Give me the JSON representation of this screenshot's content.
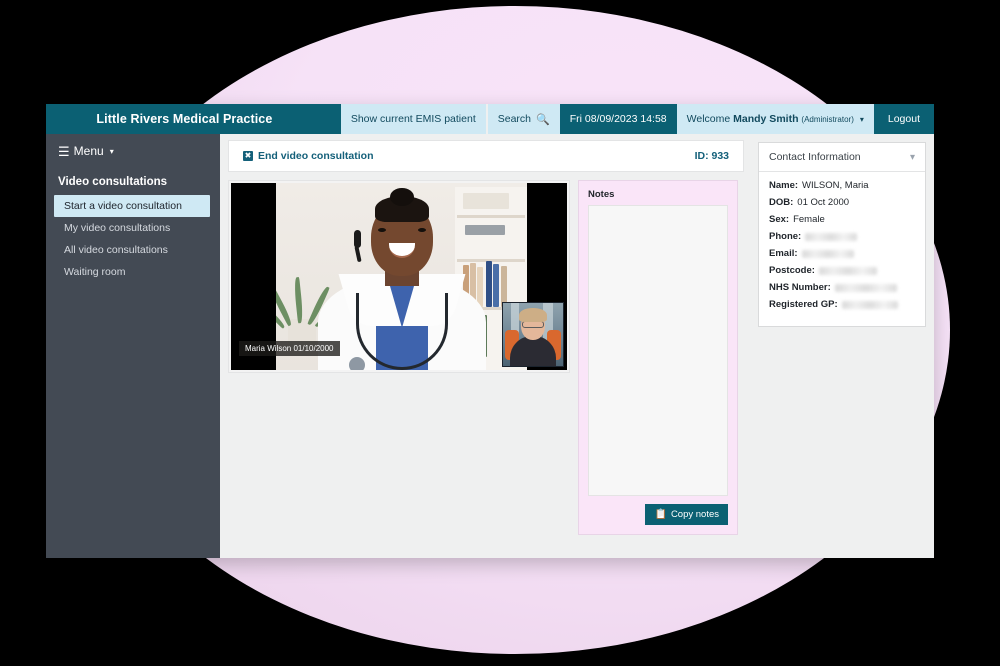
{
  "app": {
    "brand": "Little Rivers Medical Practice"
  },
  "topbar": {
    "emis_button": "Show current EMIS patient",
    "search_label": "Search",
    "search_icon": "search-icon",
    "datetime": "Fri 08/09/2023 14:58",
    "welcome_prefix": "Welcome",
    "user_name": "Mandy Smith",
    "user_role": "(Administrator)",
    "user_caret": "▾",
    "logout": "Logout"
  },
  "sidebar": {
    "menu_label": "Menu",
    "menu_caret": "▾",
    "section_title": "Video consultations",
    "items": [
      {
        "label": "Start a video consultation",
        "active": true
      },
      {
        "label": "My video consultations",
        "active": false
      },
      {
        "label": "All video consultations",
        "active": false
      },
      {
        "label": "Waiting room",
        "active": false
      }
    ]
  },
  "consultation": {
    "end_label": "End video consultation",
    "end_icon": "close-box-icon",
    "id_label": "ID: 933",
    "participant_badge": "Maria Wilson 01/10/2000",
    "remote_participant": "clinician-video",
    "self_view": "patient-self-view"
  },
  "notes": {
    "label": "Notes",
    "value": "",
    "placeholder": "",
    "copy_label": "Copy notes",
    "copy_icon": "copy-icon"
  },
  "contact": {
    "title": "Contact Information",
    "collapse_icon": "chevron-down-icon",
    "fields": [
      {
        "label": "Name:",
        "value": "WILSON, Maria",
        "redacted": false,
        "redact_width": 0
      },
      {
        "label": "DOB:",
        "value": "01 Oct 2000",
        "redacted": false,
        "redact_width": 0
      },
      {
        "label": "Sex:",
        "value": "Female",
        "redacted": false,
        "redact_width": 0
      },
      {
        "label": "Phone:",
        "value": "",
        "redacted": true,
        "redact_width": 52
      },
      {
        "label": "Email:",
        "value": "",
        "redacted": true,
        "redact_width": 52
      },
      {
        "label": "Postcode:",
        "value": "",
        "redacted": true,
        "redact_width": 58
      },
      {
        "label": "NHS Number:",
        "value": "",
        "redacted": true,
        "redact_width": 62
      },
      {
        "label": "Registered GP:",
        "value": "",
        "redacted": true,
        "redact_width": 56
      }
    ]
  },
  "theme": {
    "teal": "#0b6073",
    "light_blue": "#cfe9f4",
    "sidebar": "#434a54",
    "pink_panel": "#fae5f8",
    "blob_pink": "#f3ddf2",
    "link_teal": "#14607a"
  }
}
